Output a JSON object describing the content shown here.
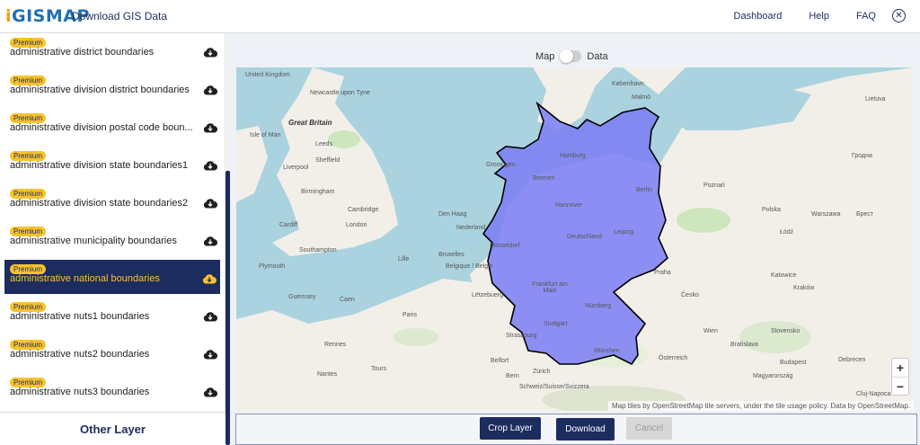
{
  "header": {
    "logo_i": "i",
    "logo_rest": "GISMAP",
    "title": "Download GIS Data",
    "nav": [
      "Dashboard",
      "Help",
      "FAQ"
    ]
  },
  "sidebar": {
    "items": [
      {
        "badge": "Premium",
        "label": "administrative district boundaries",
        "selected": false
      },
      {
        "badge": "Premium",
        "label": "administrative division district boundaries",
        "selected": false
      },
      {
        "badge": "Premium",
        "label": "administrative division postal code boun...",
        "selected": false
      },
      {
        "badge": "Premium",
        "label": "administrative division state boundaries1",
        "selected": false
      },
      {
        "badge": "Premium",
        "label": "administrative division state boundaries2",
        "selected": false
      },
      {
        "badge": "Premium",
        "label": "administrative municipality boundaries",
        "selected": false
      },
      {
        "badge": "Premium",
        "label": "administrative national boundaries",
        "selected": true
      },
      {
        "badge": "Premium",
        "label": "administrative nuts1 boundaries",
        "selected": false
      },
      {
        "badge": "Premium",
        "label": "administrative nuts2 boundaries",
        "selected": false
      },
      {
        "badge": "Premium",
        "label": "administrative nuts3 boundaries",
        "selected": false
      }
    ],
    "footer": "Other Layer"
  },
  "view_toggle": {
    "left": "Map",
    "right": "Data",
    "active": "Map"
  },
  "map": {
    "attribution": "Map tiles by OpenStreetMap tile servers, under the tile usage policy. Data by OpenStreetMap.",
    "zoom_in": "+",
    "zoom_out": "−",
    "labels": {
      "uk": "United Kingdom",
      "great_britain": "Great Britain",
      "newcastle": "Newcastle upon Tyne",
      "isle_of_man": "Isle of Man",
      "leeds": "Leeds",
      "liverpool": "Liverpool",
      "sheffield": "Sheffield",
      "birmingham": "Birmingham",
      "cambridge": "Cambridge",
      "london": "London",
      "cardiff": "Cardiff",
      "southampton": "Southampton",
      "plymouth": "Plymouth",
      "guernsey": "Guernsey",
      "caen": "Caen",
      "paris": "Paris",
      "rennes": "Rennes",
      "nantes": "Nantes",
      "tours": "Tours",
      "belfort": "Belfort",
      "strasbourg": "Strasbourg",
      "den_haag": "Den Haag",
      "nederland": "Nederland",
      "lille": "Lille",
      "belgique": "Belgique / België",
      "brussels": "Bruxelles",
      "luxembourg": "Lëtzebuerg",
      "groningen": "Groningen",
      "kobenhavn": "København",
      "malmo": "Malmö",
      "hamburg": "Hamburg",
      "bremen": "Bremen",
      "berlin": "Berlin",
      "hannover": "Hannover",
      "deutschland": "Deutschland",
      "leipzig": "Leipzig",
      "dusseldorf": "Düsseldorf",
      "frankfurt": "Frankfurt am Main",
      "nurnberg": "Nürnberg",
      "stuttgart": "Stuttgart",
      "munchen": "München",
      "poznan": "Poznań",
      "polska": "Polska",
      "warszawa": "Warszawa",
      "lodz": "Łódź",
      "katowice": "Katowice",
      "krakow": "Kraków",
      "praha": "Praha",
      "cesko": "Česko",
      "wien": "Wien",
      "osterreich": "Österreich",
      "bratislava": "Bratislava",
      "budapest": "Budapest",
      "magyarorszag": "Magyarország",
      "slovensko": "Slovensko",
      "schweiz": "Schweiz/Suisse/Svizzera",
      "bern": "Bern",
      "lietuva": "Lietuva",
      "hrodna": "Гродна",
      "brest": "Брест",
      "zurich": "Zürich",
      "debrecen": "Debrecen",
      "cluj": "Cluj-Napoca"
    }
  },
  "actions": {
    "crop": "Crop Layer",
    "download": "Download",
    "cancel": "Cancel"
  },
  "colors": {
    "brand_navy": "#1d2c5f",
    "premium_badge": "#f7c22b",
    "map_overlay": "#7b7df5"
  }
}
